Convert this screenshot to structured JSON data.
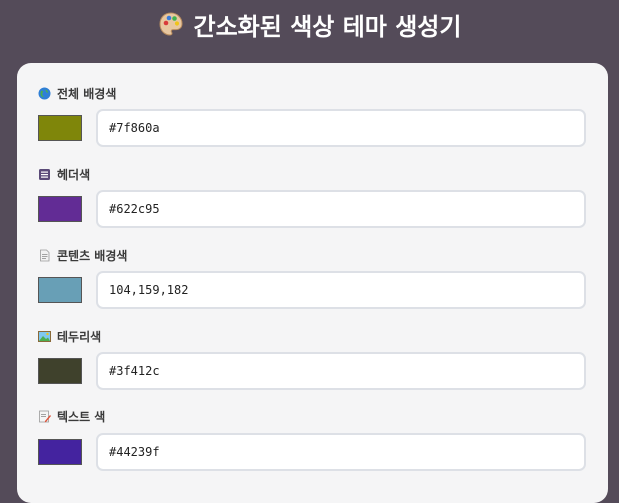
{
  "header": {
    "title": "간소화된 색상 테마 생성기",
    "icon": "palette-icon"
  },
  "fields": [
    {
      "label": "전체 배경색",
      "icon": "globe-icon",
      "swatch_color": "#7f860a",
      "value": "#7f860a"
    },
    {
      "label": "헤더색",
      "icon": "calendar-icon",
      "swatch_color": "#622c95",
      "value": "#622c95"
    },
    {
      "label": "콘텐츠 배경색",
      "icon": "document-icon",
      "swatch_color": "#689fb6",
      "value": "104,159,182"
    },
    {
      "label": "테두리색",
      "icon": "picture-icon",
      "swatch_color": "#3f412c",
      "value": "#3f412c"
    },
    {
      "label": "텍스트 색",
      "icon": "memo-icon",
      "swatch_color": "#44239f",
      "value": "#44239f"
    }
  ]
}
